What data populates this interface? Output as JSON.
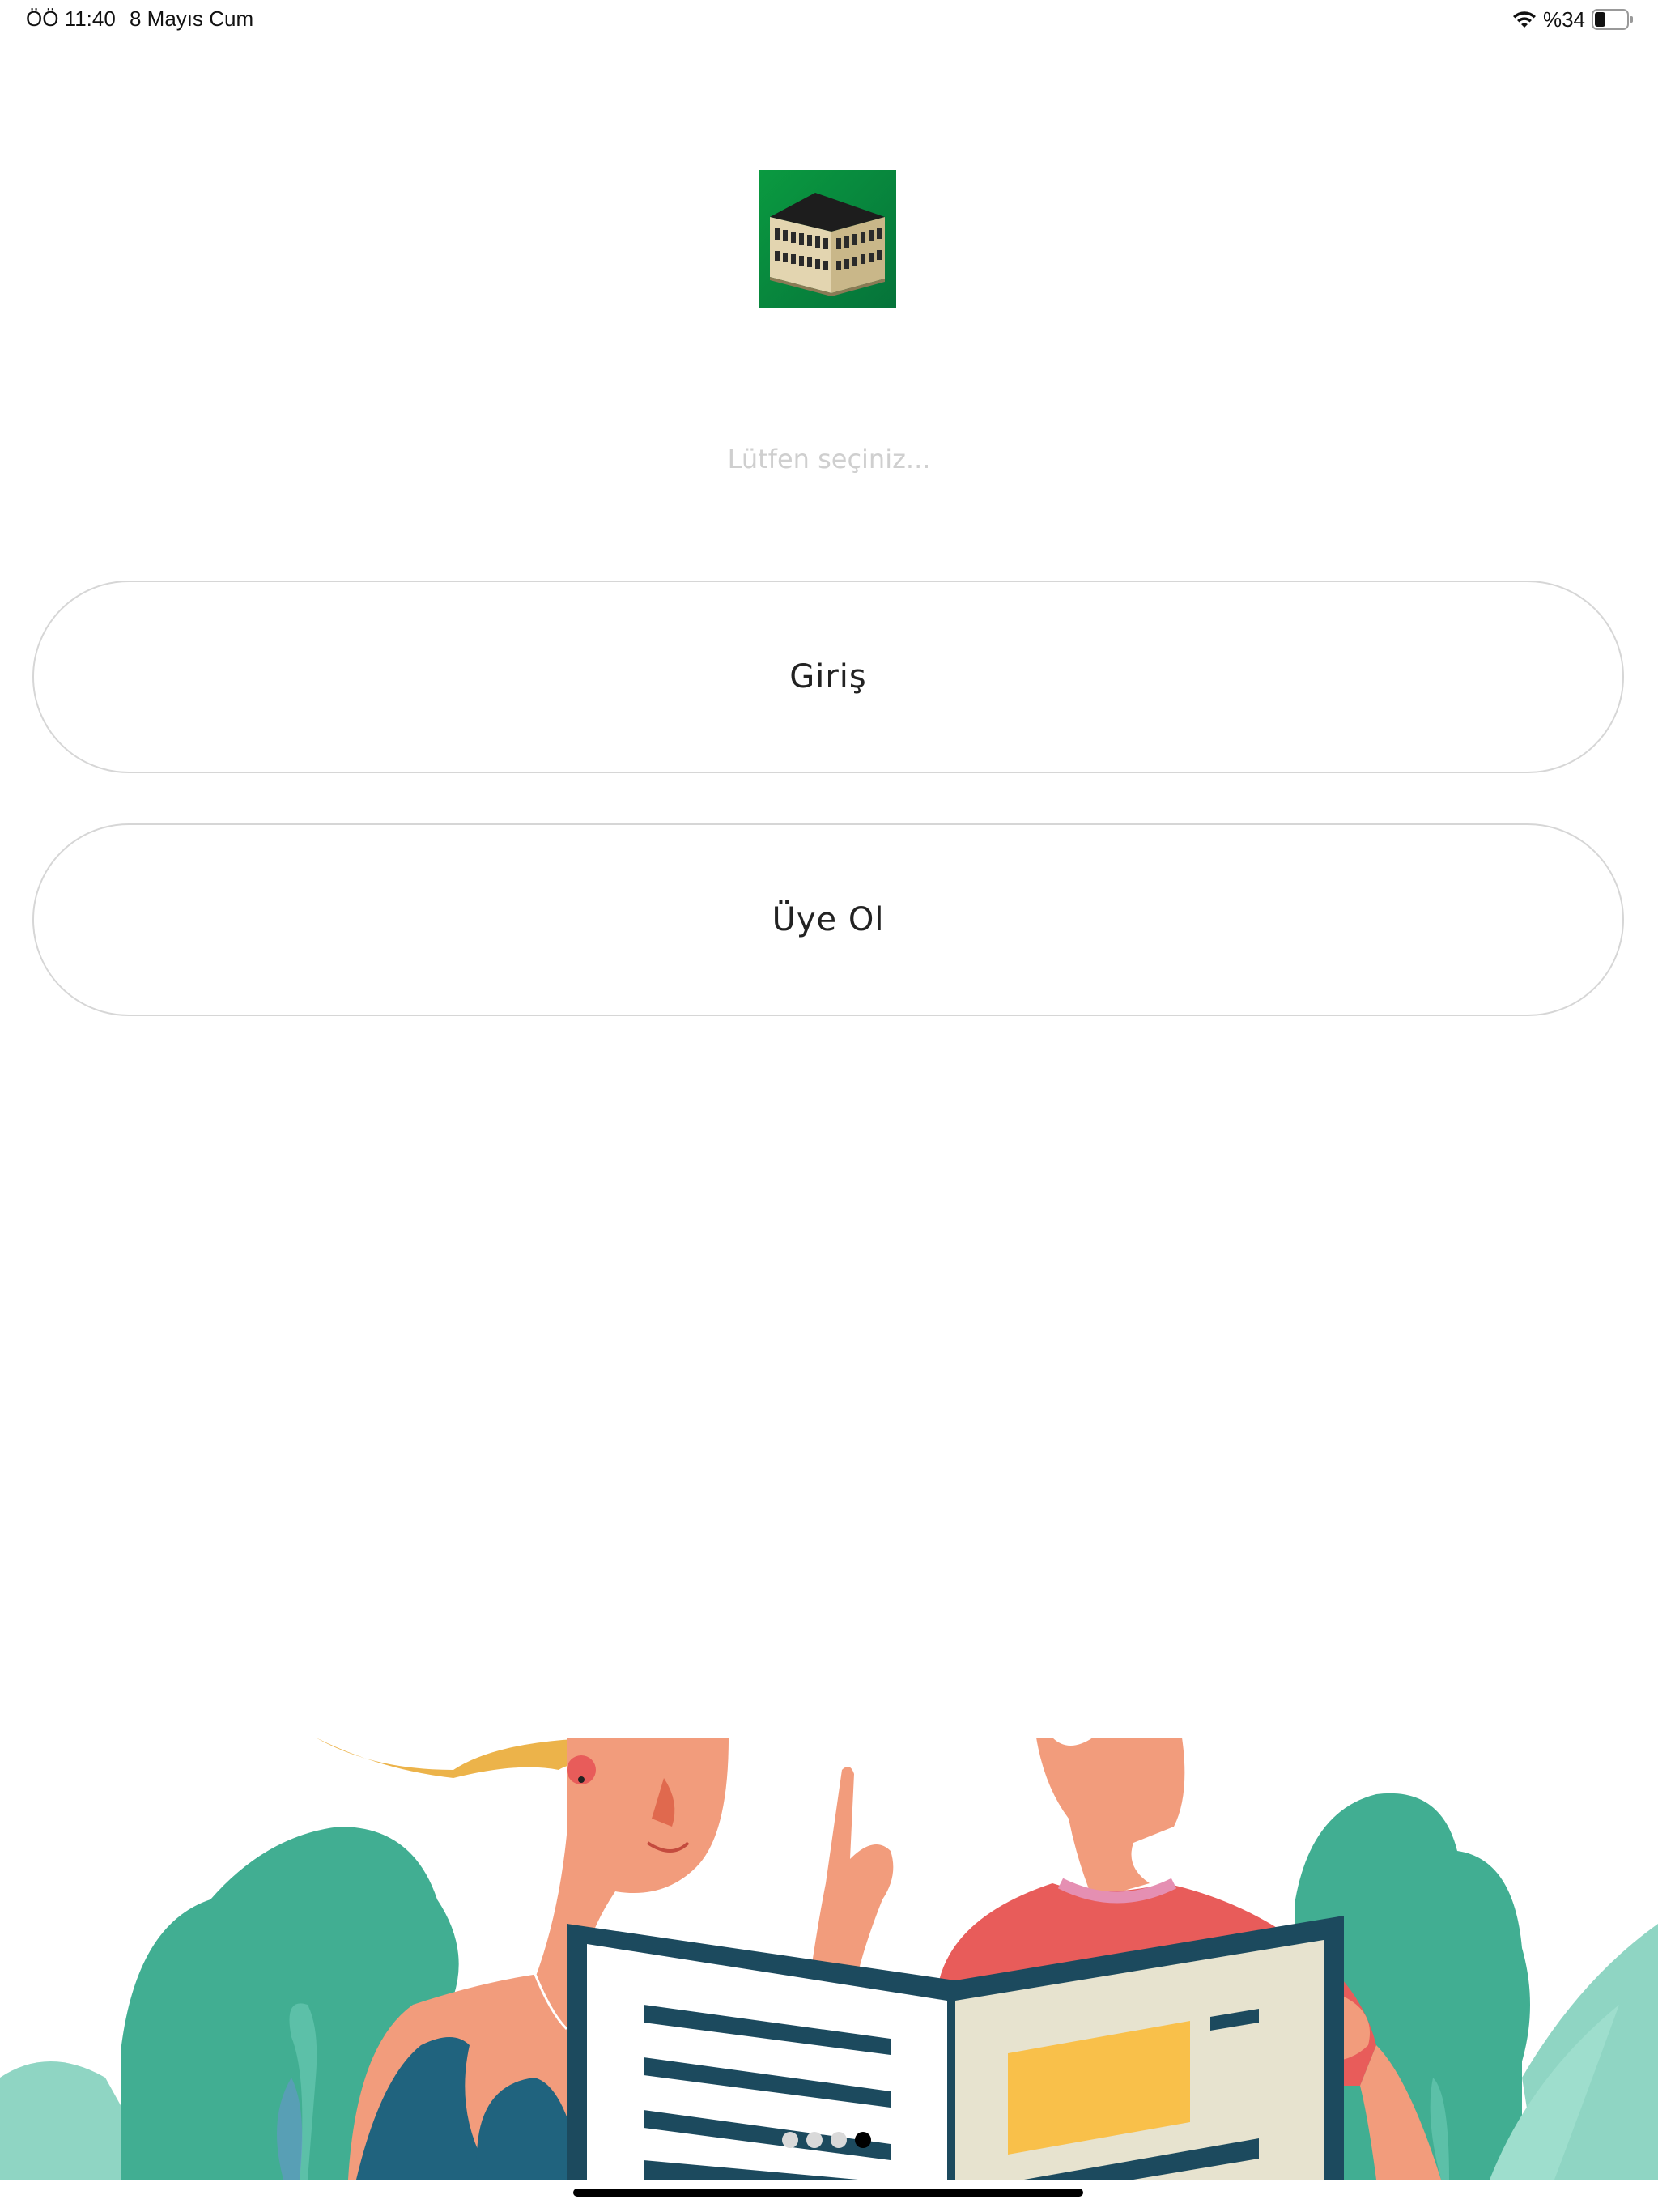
{
  "status_bar": {
    "time": "ÖÖ 11:40",
    "date": "8 Mayıs Cum",
    "battery_percent": "%34",
    "battery_level": 0.34,
    "icons": [
      "wifi-icon",
      "battery-icon"
    ]
  },
  "logo": {
    "icon": "building-logo",
    "background_color": "#0a8f3c"
  },
  "prompt": {
    "text": "Lütfen seçiniz..."
  },
  "buttons": {
    "login_label": "Giriş",
    "register_label": "Üye Ol"
  },
  "illustration": {
    "icon": "people-reading-newspaper-illustration"
  },
  "pager": {
    "count": 4,
    "active_index": 3
  },
  "colors": {
    "button_border": "#d6d6d6",
    "prompt_text": "#cfcfcf",
    "illustration_green": "#41ae92",
    "illustration_yellow": "#f9c04a"
  }
}
